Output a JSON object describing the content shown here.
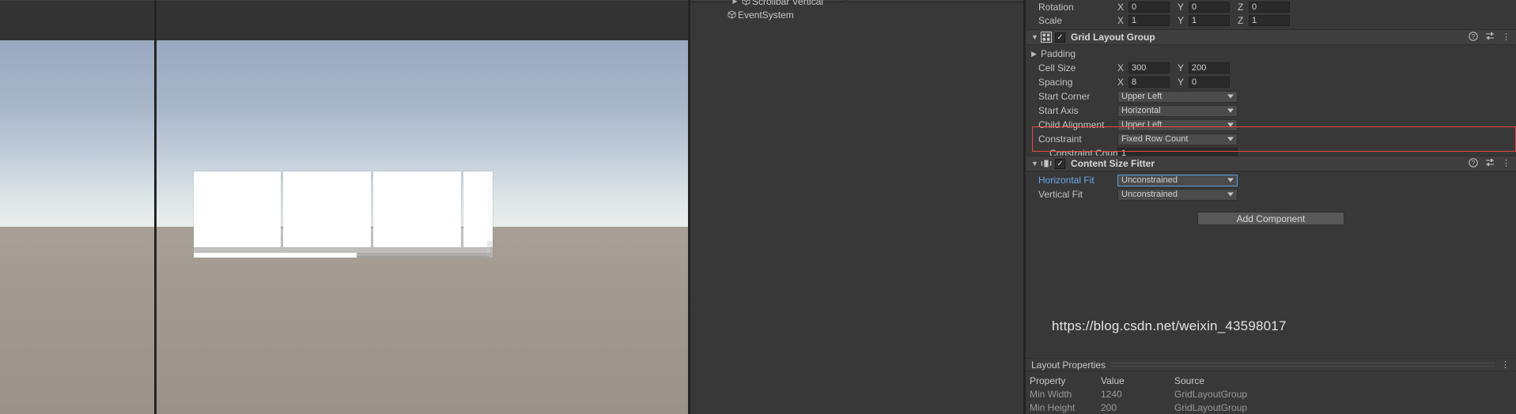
{
  "scene": {
    "name": "scene-view",
    "sky_color": "#a8b6c9",
    "ground_color": "#a39b91",
    "panel_color": "#ffffff",
    "panel_count": 4
  },
  "hierarchy": {
    "items": [
      {
        "label": "Scrollbar Vertical",
        "icon": "cube-icon",
        "expandable": true
      },
      {
        "label": "EventSystem",
        "icon": "cube-icon",
        "expandable": false
      }
    ]
  },
  "inspector": {
    "transform": {
      "rows": [
        {
          "label": "Rotation",
          "axes": [
            {
              "axis": "X",
              "value": "0"
            },
            {
              "axis": "Y",
              "value": "0"
            },
            {
              "axis": "Z",
              "value": "0"
            }
          ]
        },
        {
          "label": "Scale",
          "axes": [
            {
              "axis": "X",
              "value": "1"
            },
            {
              "axis": "Y",
              "value": "1"
            },
            {
              "axis": "Z",
              "value": "1"
            }
          ]
        }
      ]
    },
    "grid_layout_group": {
      "title": "Grid Layout Group",
      "enabled": true,
      "icon": "grid-layout-icon",
      "help_icon": "help-icon",
      "preset_icon": "preset-icon",
      "menu_icon": "kebab-menu-icon",
      "padding_label": "Padding",
      "cell_size": {
        "label": "Cell Size",
        "x": "300",
        "y": "200"
      },
      "spacing": {
        "label": "Spacing",
        "x": "8",
        "y": "0"
      },
      "start_corner": {
        "label": "Start Corner",
        "value": "Upper Left"
      },
      "start_axis": {
        "label": "Start Axis",
        "value": "Horizontal"
      },
      "child_alignment": {
        "label": "Child Alignment",
        "value": "Upper Left"
      },
      "constraint": {
        "label": "Constraint",
        "value": "Fixed Row Count"
      },
      "constraint_count": {
        "label": "Constraint Count",
        "value": "1"
      },
      "highlight_color": "#e8483f"
    },
    "content_size_fitter": {
      "title": "Content Size Fitter",
      "enabled": true,
      "icon": "content-size-fitter-icon",
      "help_icon": "help-icon",
      "preset_icon": "preset-icon",
      "menu_icon": "kebab-menu-icon",
      "horizontal_fit": {
        "label": "Horizontal Fit",
        "value": "Unconstrained",
        "override": true,
        "override_color": "#6ba7e8"
      },
      "vertical_fit": {
        "label": "Vertical Fit",
        "value": "Unconstrained",
        "override": false
      }
    },
    "add_component_label": "Add Component",
    "layout_properties": {
      "title": "Layout Properties",
      "menu_icon": "kebab-menu-icon",
      "columns": [
        "Property",
        "Value",
        "Source"
      ],
      "rows": [
        {
          "property": "Min Width",
          "value": "1240",
          "source": "GridLayoutGroup"
        },
        {
          "property": "Min Height",
          "value": "200",
          "source": "GridLayoutGroup"
        }
      ]
    }
  },
  "watermark": {
    "text": "https://blog.csdn.net/weixin_43598017"
  }
}
